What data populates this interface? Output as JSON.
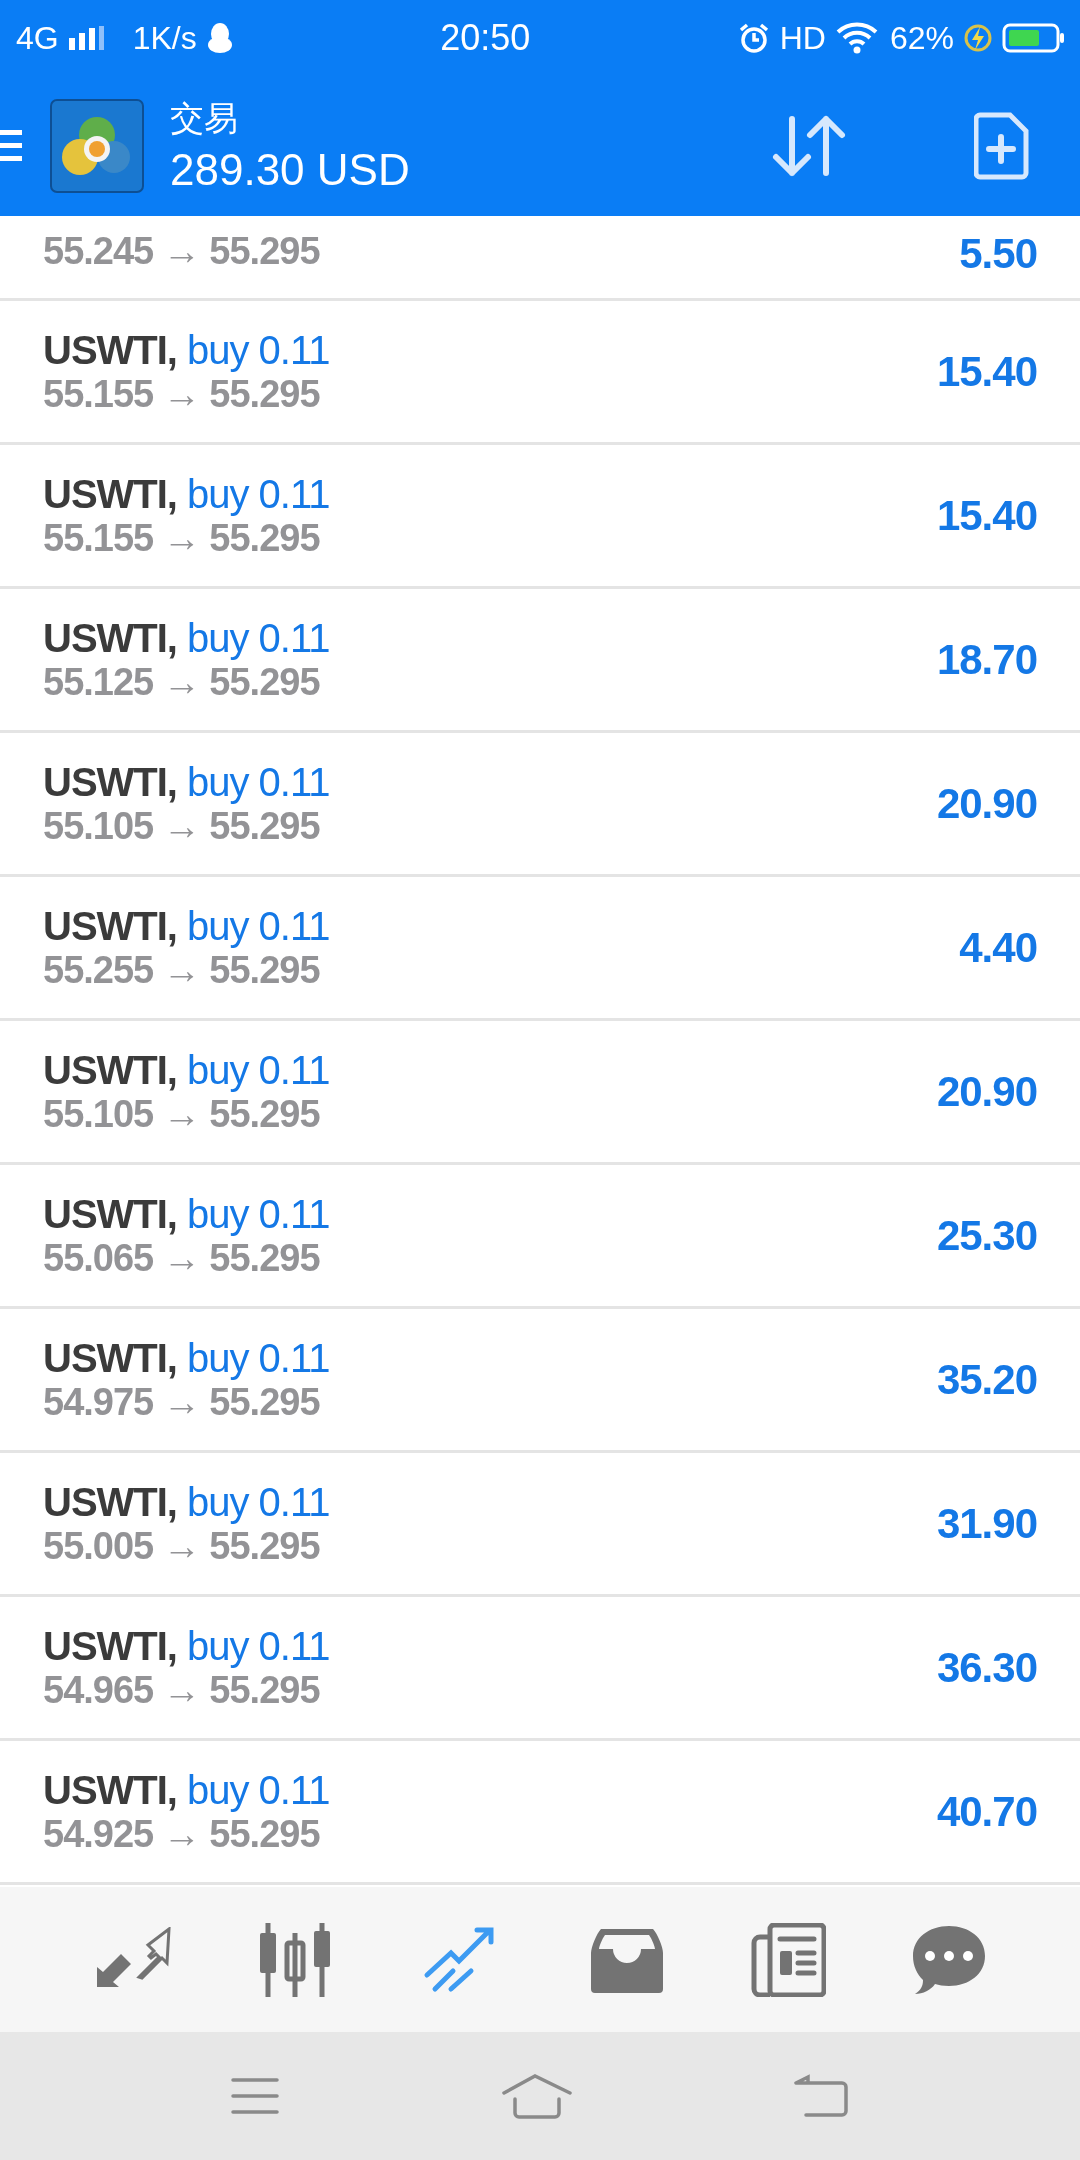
{
  "status_bar": {
    "network": "4G",
    "speed": "1K/s",
    "time": "20:50",
    "hd": "HD",
    "battery": "62%"
  },
  "header": {
    "title": "交易",
    "balance": "289.30 USD"
  },
  "positions": [
    {
      "kind": "cut",
      "prices": "55.245 → 55.295",
      "profit": "5.50"
    },
    {
      "kind": "full",
      "symbol": "USWTI,",
      "order": "buy 0.11",
      "prices": "55.155 → 55.295",
      "profit": "15.40"
    },
    {
      "kind": "full",
      "symbol": "USWTI,",
      "order": "buy 0.11",
      "prices": "55.155 → 55.295",
      "profit": "15.40"
    },
    {
      "kind": "full",
      "symbol": "USWTI,",
      "order": "buy 0.11",
      "prices": "55.125 → 55.295",
      "profit": "18.70"
    },
    {
      "kind": "full",
      "symbol": "USWTI,",
      "order": "buy 0.11",
      "prices": "55.105 → 55.295",
      "profit": "20.90"
    },
    {
      "kind": "full",
      "symbol": "USWTI,",
      "order": "buy 0.11",
      "prices": "55.255 → 55.295",
      "profit": "4.40"
    },
    {
      "kind": "full",
      "symbol": "USWTI,",
      "order": "buy 0.11",
      "prices": "55.105 → 55.295",
      "profit": "20.90"
    },
    {
      "kind": "full",
      "symbol": "USWTI,",
      "order": "buy 0.11",
      "prices": "55.065 → 55.295",
      "profit": "25.30"
    },
    {
      "kind": "full",
      "symbol": "USWTI,",
      "order": "buy 0.11",
      "prices": "54.975 → 55.295",
      "profit": "35.20"
    },
    {
      "kind": "full",
      "symbol": "USWTI,",
      "order": "buy 0.11",
      "prices": "55.005 → 55.295",
      "profit": "31.90"
    },
    {
      "kind": "full",
      "symbol": "USWTI,",
      "order": "buy 0.11",
      "prices": "54.965 → 55.295",
      "profit": "36.30"
    },
    {
      "kind": "full",
      "symbol": "USWTI,",
      "order": "buy 0.11",
      "prices": "54.925 → 55.295",
      "profit": "40.70"
    }
  ],
  "tab_bar": [
    {
      "kind": "quotes",
      "selected": false
    },
    {
      "kind": "chart",
      "selected": false
    },
    {
      "kind": "trade",
      "selected": true
    },
    {
      "kind": "history",
      "selected": false
    },
    {
      "kind": "news",
      "selected": false
    },
    {
      "kind": "chat",
      "selected": false
    }
  ]
}
